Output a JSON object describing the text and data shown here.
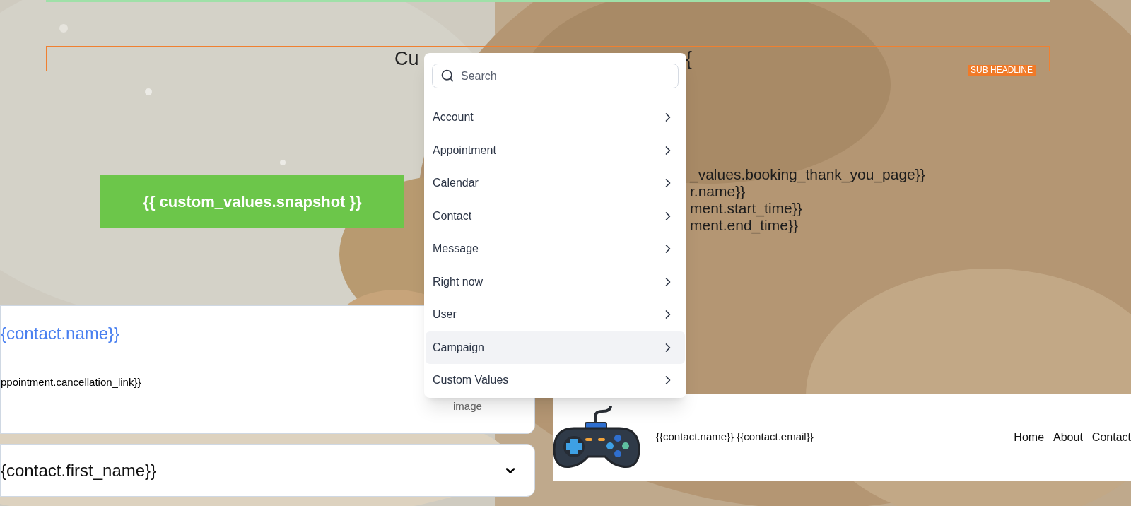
{
  "sub_headline": {
    "text_start": "Cu",
    "text_end": "{",
    "badge": "SUB HEADLINE"
  },
  "button": {
    "label": "{{ custom_values.snapshot }}"
  },
  "text_block": {
    "lines": [
      "_values.booking_thank_you_page}}",
      "r.name}}",
      "ment.start_time}}",
      "ment.end_time}}"
    ]
  },
  "card": {
    "title": "{contact.name}}",
    "link": "ppointment.cancellation_link}}",
    "image_label": "image"
  },
  "select": {
    "value": "{contact.first_name}}"
  },
  "nav_bar": {
    "text": "{{contact.name}} {{contact.email}}",
    "links": [
      "Home",
      "About",
      "Contact"
    ]
  },
  "dropdown_menu": {
    "search": {
      "placeholder": "Search"
    },
    "items": [
      {
        "label": "Account",
        "selected": false
      },
      {
        "label": "Appointment",
        "selected": false
      },
      {
        "label": "Calendar",
        "selected": false
      },
      {
        "label": "Contact",
        "selected": false
      },
      {
        "label": "Message",
        "selected": false
      },
      {
        "label": "Right now",
        "selected": false
      },
      {
        "label": "User",
        "selected": false
      },
      {
        "label": "Campaign",
        "selected": true
      },
      {
        "label": "Custom Values",
        "selected": false
      }
    ]
  }
}
